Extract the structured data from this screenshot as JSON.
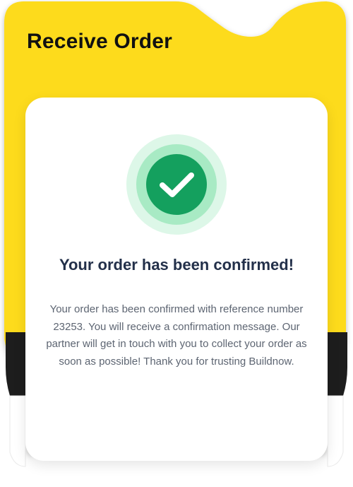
{
  "header": {
    "title": "Receive Order"
  },
  "confirmation": {
    "icon": "check-circle-icon",
    "headline": "Your order has been confirmed!",
    "message": "Your order has been confirmed with reference number 23253. You will receive a confirmation message. Our partner will get in touch with you to collect your order as soon as possible! Thank you for trusting Buildnow."
  },
  "colors": {
    "accent_yellow": "#FDDB1A",
    "success_green": "#14A05E",
    "success_ring_outer": "#D8F6E4",
    "success_ring_inner": "#9BE5BC",
    "headline_color": "#23304A",
    "body_color": "#5D6572"
  }
}
